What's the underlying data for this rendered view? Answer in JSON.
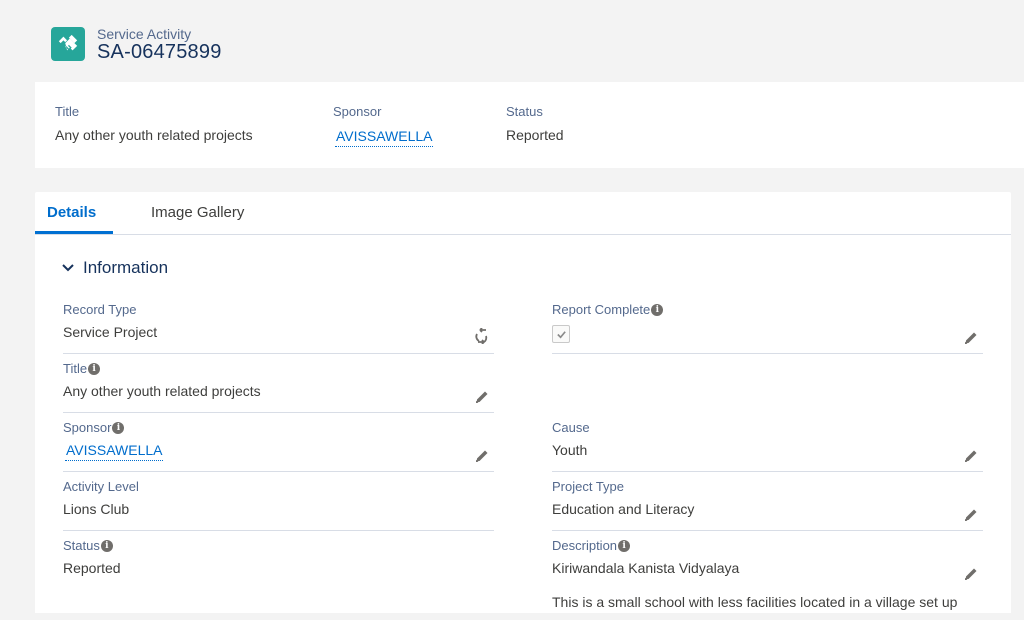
{
  "header": {
    "object_label": "Service Activity",
    "record_name": "SA-06475899",
    "icon": "handshake-icon"
  },
  "highlights": [
    {
      "label": "Title",
      "value": "Any other youth related projects"
    },
    {
      "label": "Sponsor",
      "value": "AVISSAWELLA"
    },
    {
      "label": "Status",
      "value": "Reported"
    }
  ],
  "tabs": [
    {
      "label": "Details",
      "active": true
    },
    {
      "label": "Image Gallery",
      "active": false
    }
  ],
  "section": {
    "title": "Information"
  },
  "fields": {
    "record_type": {
      "label": "Record Type",
      "value": "Service Project"
    },
    "title": {
      "label": "Title",
      "value": "Any other youth related projects"
    },
    "sponsor": {
      "label": "Sponsor",
      "value": "AVISSAWELLA"
    },
    "activity_level": {
      "label": "Activity Level",
      "value": "Lions Club"
    },
    "status": {
      "label": "Status",
      "value": "Reported"
    },
    "report_complete": {
      "label": "Report Complete",
      "checked": true
    },
    "cause": {
      "label": "Cause",
      "value": "Youth"
    },
    "project_type": {
      "label": "Project Type",
      "value": "Education and Literacy"
    },
    "description": {
      "label": "Description",
      "value": "Kiriwandala Kanista Vidyalaya",
      "value_more": "This is a small school with less facilities located in a village set up"
    }
  },
  "colors": {
    "accent": "#0070d2",
    "link": "#006dcc",
    "icon_bg": "#26a69a"
  }
}
